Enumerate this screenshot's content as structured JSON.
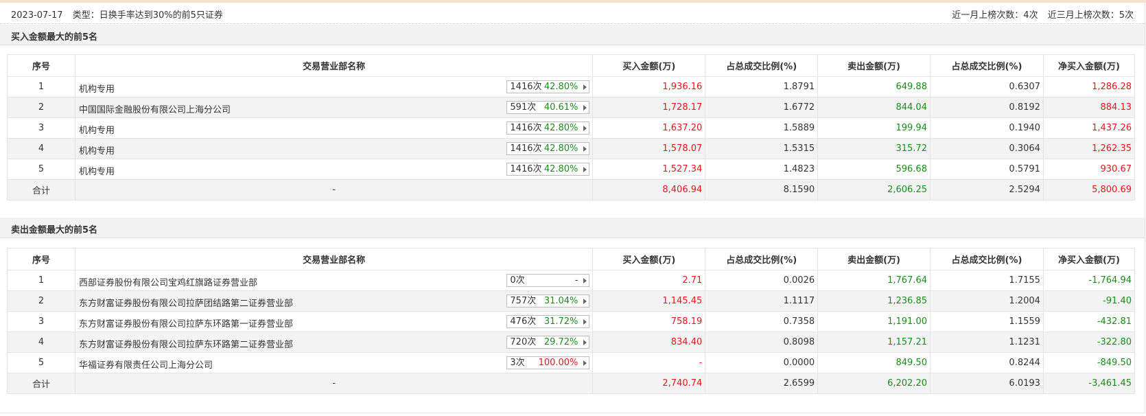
{
  "header": {
    "date": "2023-07-17",
    "type_text": "类型：日换手率达到30%的前5只证券",
    "month_count": "近一月上榜次数：4次",
    "quarter_count": "近三月上榜次数：5次"
  },
  "columns": [
    "序号",
    "交易营业部名称",
    "买入金额(万)",
    "占总成交比例(%)",
    "卖出金额(万)",
    "占总成交比例(%)",
    "净买入金额(万)"
  ],
  "buy_section": {
    "title": "买入金额最大的前5名",
    "rows": [
      {
        "idx": "1",
        "name": "机构专用",
        "count": "1416次",
        "pct": "42.80%",
        "buy": "1,936.16",
        "buy_ratio": "1.8791",
        "sell": "649.88",
        "sell_ratio": "0.6307",
        "net": "1,286.28"
      },
      {
        "idx": "2",
        "name": "中国国际金融股份有限公司上海分公司",
        "count": "591次",
        "pct": "40.61%",
        "buy": "1,728.17",
        "buy_ratio": "1.6772",
        "sell": "844.04",
        "sell_ratio": "0.8192",
        "net": "884.13"
      },
      {
        "idx": "3",
        "name": "机构专用",
        "count": "1416次",
        "pct": "42.80%",
        "buy": "1,637.20",
        "buy_ratio": "1.5889",
        "sell": "199.94",
        "sell_ratio": "0.1940",
        "net": "1,437.26"
      },
      {
        "idx": "4",
        "name": "机构专用",
        "count": "1416次",
        "pct": "42.80%",
        "buy": "1,578.07",
        "buy_ratio": "1.5315",
        "sell": "315.72",
        "sell_ratio": "0.3064",
        "net": "1,262.35"
      },
      {
        "idx": "5",
        "name": "机构专用",
        "count": "1416次",
        "pct": "42.80%",
        "buy": "1,527.34",
        "buy_ratio": "1.4823",
        "sell": "596.68",
        "sell_ratio": "0.5791",
        "net": "930.67"
      }
    ],
    "total": {
      "label": "合计",
      "name": "-",
      "buy": "8,406.94",
      "buy_ratio": "8.1590",
      "sell": "2,606.25",
      "sell_ratio": "2.5294",
      "net": "5,800.69"
    }
  },
  "sell_section": {
    "title": "卖出金额最大的前5名",
    "rows": [
      {
        "idx": "1",
        "name": "西部证券股份有限公司宝鸡红旗路证券营业部",
        "count": "0次",
        "pct": "-",
        "buy": "2.71",
        "buy_ratio": "0.0026",
        "sell": "1,767.64",
        "sell_ratio": "1.7155",
        "net": "-1,764.94"
      },
      {
        "idx": "2",
        "name": "东方财富证券股份有限公司拉萨团结路第二证券营业部",
        "count": "757次",
        "pct": "31.04%",
        "buy": "1,145.45",
        "buy_ratio": "1.1117",
        "sell": "1,236.85",
        "sell_ratio": "1.2004",
        "net": "-91.40"
      },
      {
        "idx": "3",
        "name": "东方财富证券股份有限公司拉萨东环路第一证券营业部",
        "count": "476次",
        "pct": "31.72%",
        "buy": "758.19",
        "buy_ratio": "0.7358",
        "sell": "1,191.00",
        "sell_ratio": "1.1559",
        "net": "-432.81"
      },
      {
        "idx": "4",
        "name": "东方财富证券股份有限公司拉萨东环路第二证券营业部",
        "count": "720次",
        "pct": "29.72%",
        "buy": "834.40",
        "buy_ratio": "0.8098",
        "sell": "1,157.21",
        "sell_ratio": "1.1231",
        "net": "-322.80"
      },
      {
        "idx": "5",
        "name": "华福证券有限责任公司上海分公司",
        "count": "3次",
        "pct": "100.00%",
        "buy": "-",
        "buy_ratio": "0.0000",
        "sell": "849.50",
        "sell_ratio": "0.8244",
        "net": "-849.50"
      }
    ],
    "total": {
      "label": "合计",
      "name": "-",
      "buy": "2,740.74",
      "buy_ratio": "2.6599",
      "sell": "6,202.20",
      "sell_ratio": "6.0193",
      "net": "-3,461.45"
    }
  },
  "colors": {
    "positive": "#e5161c",
    "negative": "#1b8a1b",
    "row_alt": "#f3f3f3",
    "section_bg": "#f2f2f2"
  },
  "icons": {
    "pill_arrow": "caret-right-icon"
  }
}
